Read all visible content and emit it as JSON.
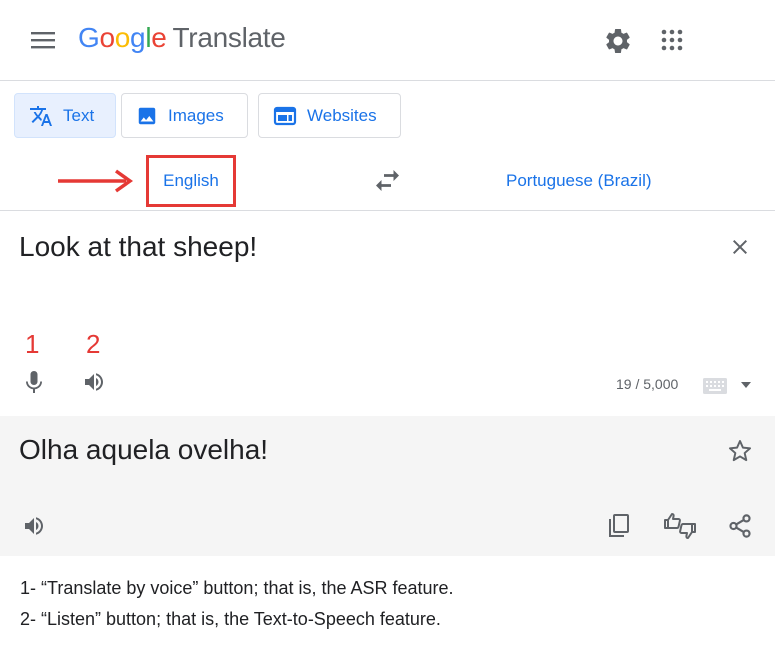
{
  "header": {
    "logo_letters": [
      "G",
      "o",
      "o",
      "g",
      "l",
      "e"
    ],
    "logo_product": "Translate",
    "icons": [
      "menu-icon",
      "settings-icon",
      "apps-icon"
    ]
  },
  "modes": {
    "text": "Text",
    "images": "Images",
    "websites": "Websites",
    "active": "text"
  },
  "languages": {
    "source": "English",
    "target": "Portuguese (Brazil)"
  },
  "source": {
    "text": "Look at that sheep!",
    "char_count": "19 / 5,000",
    "annotation_1": "1",
    "annotation_2": "2"
  },
  "target": {
    "text": "Olha aquela ovelha!"
  },
  "caption": {
    "line1": "1- “Translate by voice” button; that is, the ASR feature.",
    "line2": "2- “Listen” button; that is, the Text-to-Speech feature."
  },
  "colors": {
    "accent_blue": "#1a73e8",
    "annotation_red": "#e53935",
    "icon_gray": "#5f6368",
    "target_panel_bg": "#f5f5f5"
  }
}
